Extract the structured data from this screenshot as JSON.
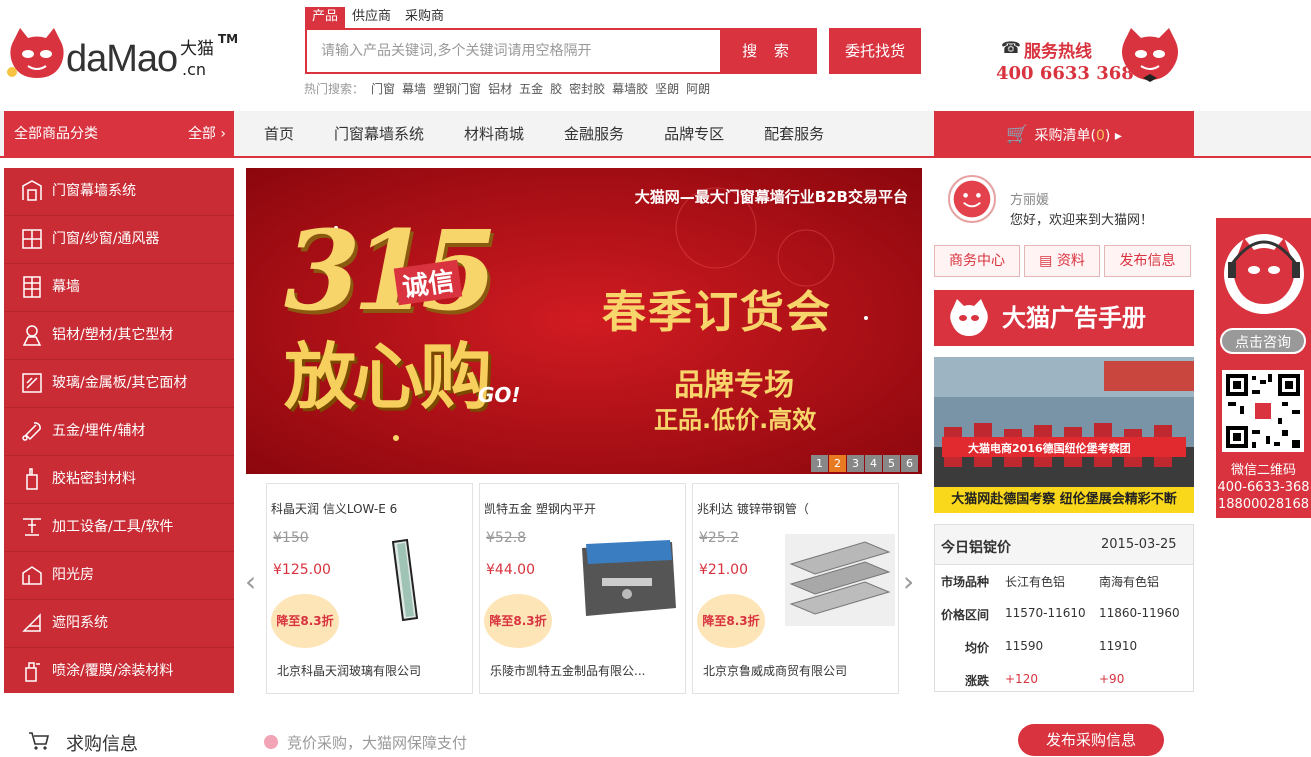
{
  "header": {
    "logo_text": "daMao",
    "logo_cn_top": "大猫",
    "logo_cn_bottom": ".cn",
    "logo_tm": "TM",
    "search_tabs": [
      "产品",
      "供应商",
      "采购商"
    ],
    "search_placeholder": "请输入产品关键词,多个关键词请用空格隔开",
    "search_button": "搜 索",
    "entrust_button": "委托找货",
    "hot_label": "热门搜索：",
    "hot_keywords": [
      "门窗",
      "幕墙",
      "塑钢门窗",
      "铝材",
      "五金",
      "胶",
      "密封胶",
      "幕墙胶",
      "坚朗",
      "阿朗"
    ],
    "hotline_label": "服务热线",
    "hotline_number": "400 6633 368"
  },
  "nav": {
    "category_head": "全部商品分类",
    "category_all": "全部",
    "items": [
      "首页",
      "门窗幕墙系统",
      "材料商城",
      "金融服务",
      "品牌专区",
      "配套服务"
    ],
    "cart_label": "采购清单(",
    "cart_count": "0",
    "cart_close": ")"
  },
  "categories": [
    {
      "label": "门窗幕墙系统",
      "icon": "building-icon"
    },
    {
      "label": "门窗/纱窗/通风器",
      "icon": "window-icon"
    },
    {
      "label": "幕墙",
      "icon": "curtain-wall-icon"
    },
    {
      "label": "铝材/塑材/其它型材",
      "icon": "profile-icon"
    },
    {
      "label": "玻璃/金属板/其它面材",
      "icon": "glass-icon"
    },
    {
      "label": "五金/埋件/辅材",
      "icon": "wrench-icon"
    },
    {
      "label": "胶粘密封材料",
      "icon": "sealant-icon"
    },
    {
      "label": "加工设备/工具/软件",
      "icon": "machine-icon"
    },
    {
      "label": "阳光房",
      "icon": "sunroom-icon"
    },
    {
      "label": "遮阳系统",
      "icon": "shade-icon"
    },
    {
      "label": "喷涂/覆膜/涂装材料",
      "icon": "spray-icon"
    }
  ],
  "banner": {
    "slogan": "大猫网—最大门窗幕墙行业B2B交易平台",
    "big_number": "315",
    "chengxin": "诚信",
    "fangxingou": "放心购",
    "go": "GO!",
    "title": "春季订货会",
    "sub1": "品牌专场",
    "sub2": "正品.低价.高效",
    "dots": [
      "1",
      "2",
      "3",
      "4",
      "5",
      "6"
    ],
    "active_dot": "2"
  },
  "products": [
    {
      "title": "科晶天润 信义LOW-E 6",
      "old_price": "¥150",
      "price": "¥125.00",
      "badge": "降至8.3折",
      "company": "北京科晶天润玻璃有限公司"
    },
    {
      "title": "凯特五金 塑钢内平开",
      "old_price": "¥52.8",
      "price": "¥44.00",
      "badge": "降至8.3折",
      "company": "乐陵市凯特五金制品有限公..."
    },
    {
      "title": "兆利达 镀锌带钢管（",
      "old_price": "¥25.2",
      "price": "¥21.00",
      "badge": "降至8.3折",
      "company": "北京京鲁威成商贸有限公司"
    }
  ],
  "user": {
    "name": "方丽媛",
    "welcome": "您好，欢迎来到大猫网！",
    "buttons": [
      "商务中心",
      "资料",
      "发布信息"
    ]
  },
  "ad_book": "大猫广告手册",
  "photo_caption": "大猫网赴德国考察 纽伦堡展会精彩不断",
  "photo_banner_text": "大猫电商2016德国纽伦堡考察团",
  "aluminum": {
    "title": "今日铝锭价",
    "date": "2015-03-25",
    "rows": [
      {
        "label": "市场品种",
        "a": "长江有色铝",
        "b": "南海有色铝"
      },
      {
        "label": "价格区间",
        "a": "11570-11610",
        "b": "11860-11960"
      },
      {
        "label": "均价",
        "a": "11590",
        "b": "11910"
      },
      {
        "label": "涨跌",
        "a": "+120",
        "b": "+90"
      }
    ]
  },
  "floating": {
    "consult": "点击咨询",
    "qr_label": "微信二维码",
    "phone1": "400-6633-368",
    "phone2": "18800028168"
  },
  "bottom": {
    "title": "求购信息",
    "notice": "竞价采购，大猫网保障支付",
    "publish": "发布采购信息"
  },
  "colors": {
    "brand": "#d8333f",
    "badge": "#fde5b8",
    "dot_active": "#e87b22"
  }
}
